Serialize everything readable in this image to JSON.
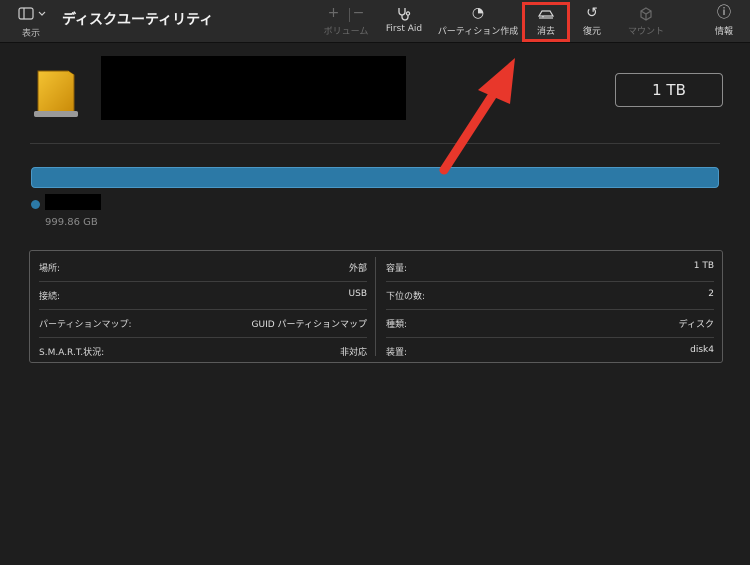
{
  "toolbar": {
    "view_label": "表示",
    "title": "ディスクユーティリティ",
    "buttons": {
      "volume": "ボリューム",
      "first_aid": "First Aid",
      "partition": "パーティション作成",
      "erase": "消去",
      "restore": "復元",
      "mount": "マウント",
      "info": "情報"
    },
    "icons": {
      "add": "+",
      "remove": "−",
      "partition": "◔",
      "restore": "↺",
      "info": "ⓘ"
    }
  },
  "disk": {
    "capacity": "1 TB"
  },
  "volume": {
    "size": "999.86 GB",
    "color": "#2c79a6"
  },
  "info": {
    "left": [
      {
        "key": "場所:",
        "value": "外部"
      },
      {
        "key": "接続:",
        "value": "USB"
      },
      {
        "key": "パーティションマップ:",
        "value": "GUID パーティションマップ"
      },
      {
        "key": "S.M.A.R.T.状況:",
        "value": "非対応"
      }
    ],
    "right": [
      {
        "key": "容量:",
        "value": "1 TB"
      },
      {
        "key": "下位の数:",
        "value": "2"
      },
      {
        "key": "種類:",
        "value": "ディスク"
      },
      {
        "key": "装置:",
        "value": "disk4"
      }
    ]
  },
  "annotation": {
    "highlight_color": "#e8372b"
  }
}
